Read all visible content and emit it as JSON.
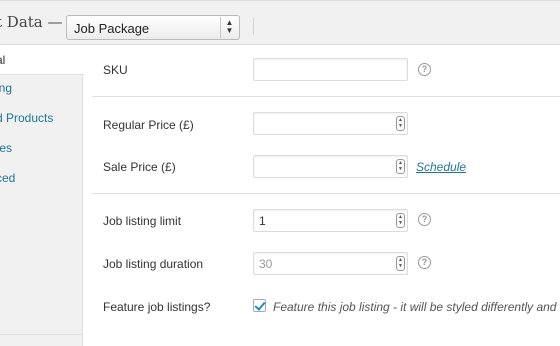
{
  "header": {
    "title": "t Data —",
    "product_type": "Job Package"
  },
  "tabs": [
    {
      "label": "al"
    },
    {
      "label": "ing"
    },
    {
      "label": "d Products"
    },
    {
      "label": "tes"
    },
    {
      "label": "ced"
    }
  ],
  "fields": {
    "sku": {
      "label": "SKU",
      "value": ""
    },
    "regular_price": {
      "label": "Regular Price (£)",
      "value": ""
    },
    "sale_price": {
      "label": "Sale Price (£)",
      "value": "",
      "schedule_link": "Schedule"
    },
    "job_listing_limit": {
      "label": "Job listing limit",
      "value": "1"
    },
    "job_listing_duration": {
      "label": "Job listing duration",
      "placeholder": "30"
    },
    "feature_listings": {
      "label": "Feature job listings?",
      "checked": true,
      "description": "Feature this job listing - it will be styled differently and"
    }
  },
  "icons": {
    "help": "?"
  },
  "colors": {
    "link": "#21759b",
    "header_bg": "#f1f1f1"
  }
}
